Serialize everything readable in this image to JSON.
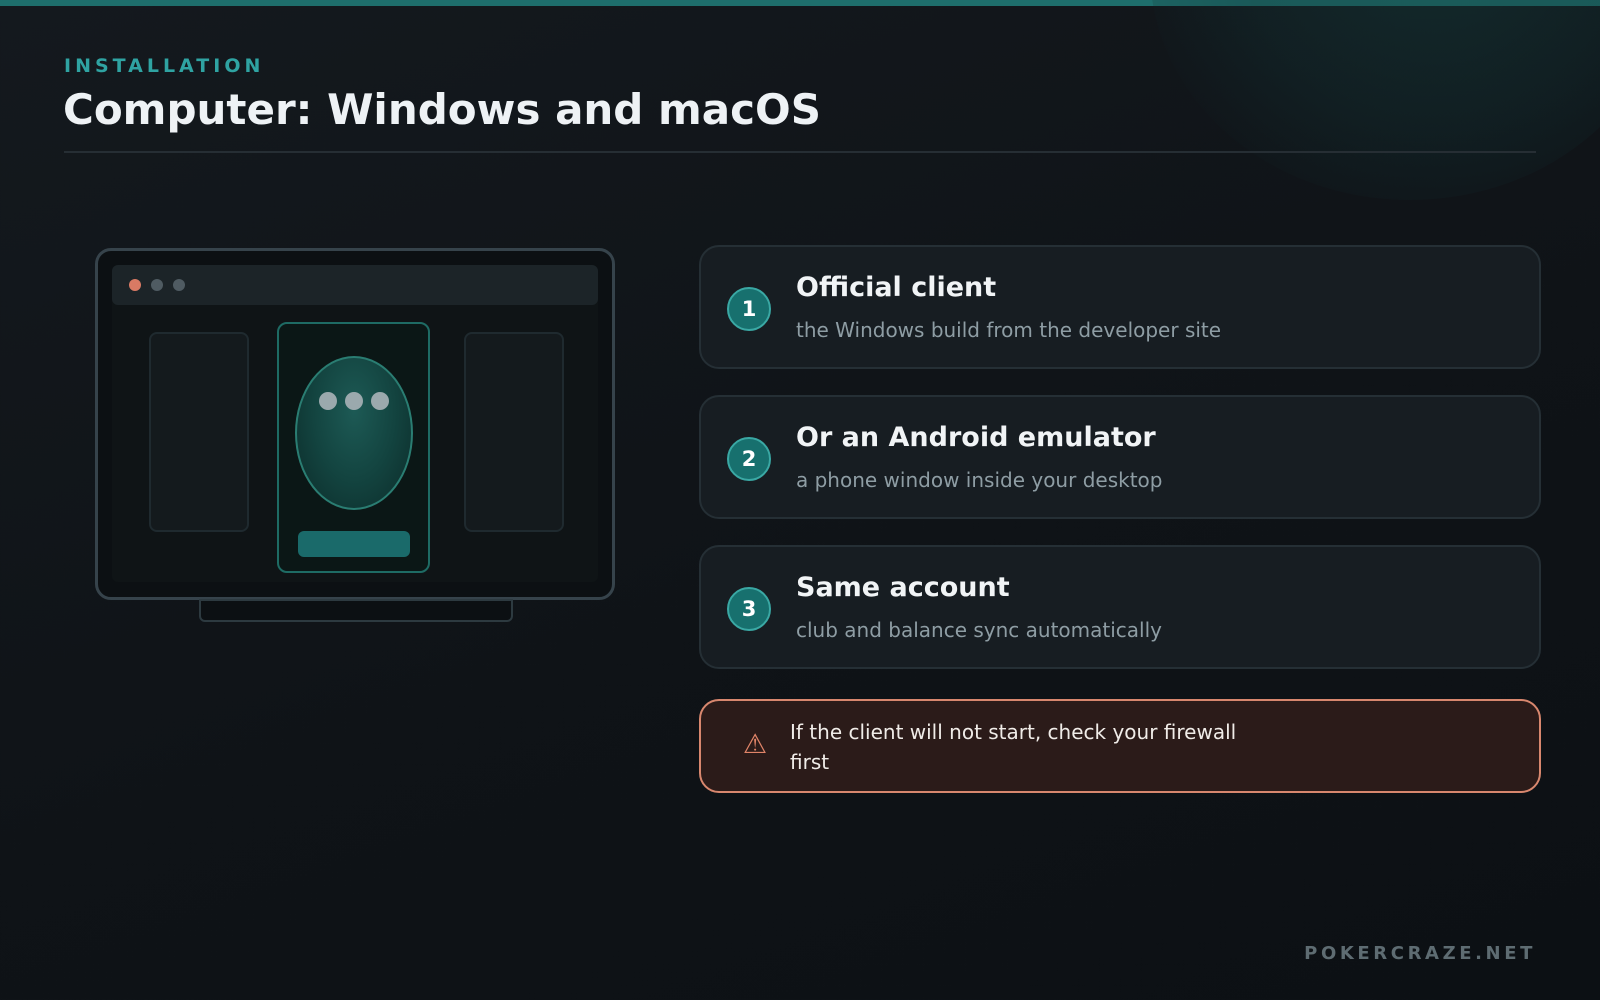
{
  "header": {
    "eyebrow": "INSTALLATION",
    "title": "Computer: Windows and macOS"
  },
  "steps": [
    {
      "number": "1",
      "title": "Official client",
      "description": "the Windows build from the developer site"
    },
    {
      "number": "2",
      "title": "Or an Android emulator",
      "description": "a phone window inside your desktop"
    },
    {
      "number": "3",
      "title": "Same account",
      "description": "club and balance sync automatically"
    }
  ],
  "warning": {
    "icon": "warning-triangle-icon",
    "glyph": "⚠",
    "text": "If the client will not start, check your firewall first"
  },
  "footer": {
    "brand": "POKERCRAZE.NET"
  },
  "colors": {
    "accent": "#2fa3a2",
    "step_badge": "#17706e",
    "warning_border": "#d8876e",
    "warning_bg": "#2b1b19",
    "window_dot_red": "#d97a64"
  }
}
